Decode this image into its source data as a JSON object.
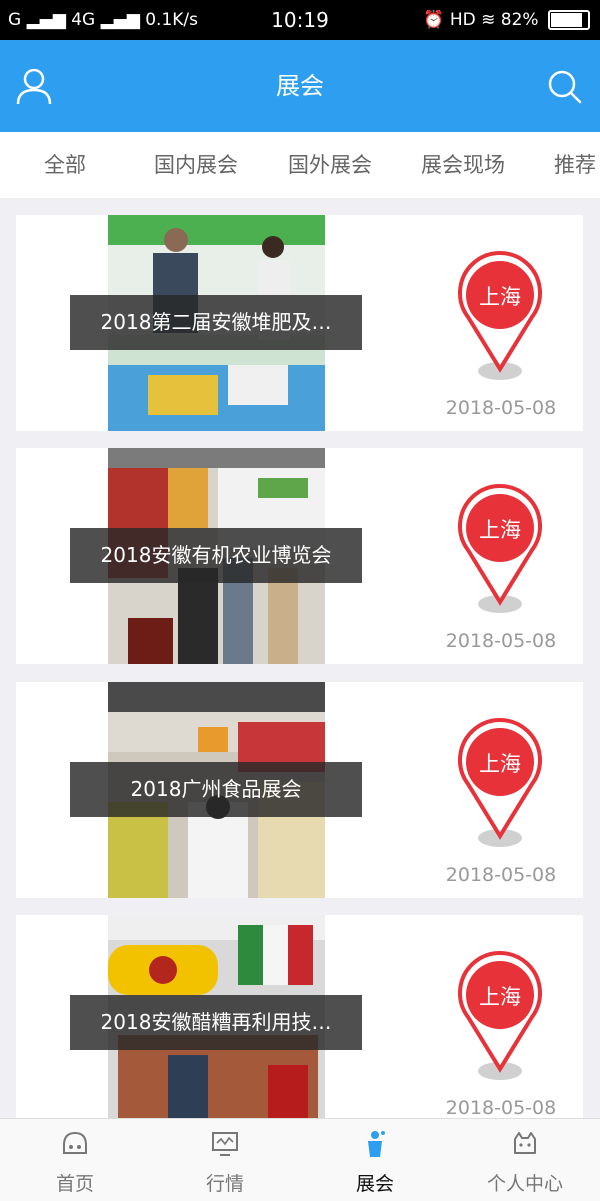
{
  "status_bar": {
    "left": "G ▂▄▆ 4G ▂▄▆ 0.1K/s",
    "time": "10:19",
    "right": "HD",
    "battery": "82%",
    "battery_level": 0.82
  },
  "header": {
    "title": "展会",
    "user_icon": "user-icon",
    "search_icon": "search-icon"
  },
  "tabs": [
    {
      "label": "全部"
    },
    {
      "label": "国内展会"
    },
    {
      "label": "国外展会"
    },
    {
      "label": "展会现场"
    },
    {
      "label": "推荐"
    }
  ],
  "cards": [
    {
      "title": "2018第二届安徽堆肥及…",
      "city": "上海",
      "date": "2018-05-08"
    },
    {
      "title": "2018安徽有机农业博览会",
      "city": "上海",
      "date": "2018-05-08"
    },
    {
      "title": "2018广州食品展会",
      "city": "上海",
      "date": "2018-05-08"
    },
    {
      "title": "2018安徽醋糟再利用技…",
      "city": "上海",
      "date": "2018-05-08"
    }
  ],
  "bottom_nav": [
    {
      "label": "首页",
      "icon": "home-icon"
    },
    {
      "label": "行情",
      "icon": "monitor-icon"
    },
    {
      "label": "展会",
      "icon": "exhibition-icon",
      "active": true
    },
    {
      "label": "个人中心",
      "icon": "profile-icon"
    }
  ],
  "colors": {
    "header": "#2d9ef0",
    "pin": "#e8323a",
    "active_nav_icon": "#2d9ef0"
  }
}
